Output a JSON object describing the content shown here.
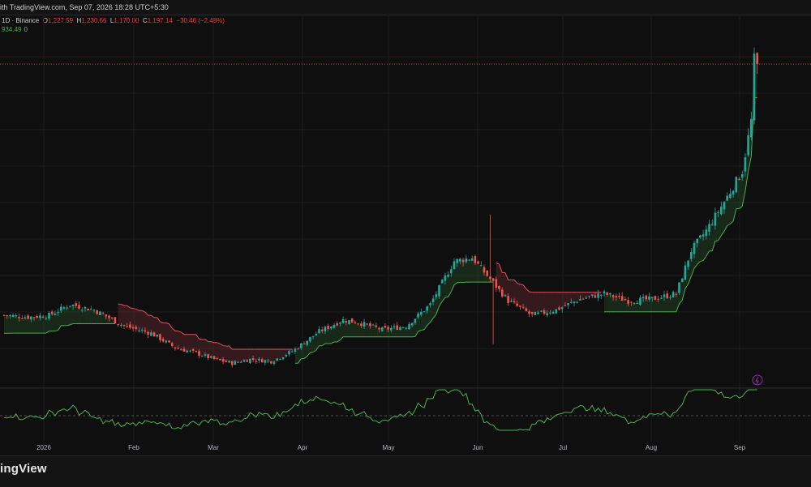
{
  "header": {
    "published_text": "ith TradingView.com, Sep 07, 2026 18:28 UTC+5:30"
  },
  "legend": {
    "interval_exchange": "1D · Binance",
    "o_label": "O",
    "open": "1,227.59",
    "h_label": "H",
    "high": "1,230.66",
    "l_label": "L",
    "low": "1,170.00",
    "c_label": "C",
    "close": "1,197.14",
    "change": "−30.46 (−2.48%)",
    "indicator_value": "934.49",
    "indicator_zero": "0"
  },
  "brand": {
    "text": "ingView"
  },
  "colors": {
    "background": "#0f0f0f",
    "up": "#26a69a",
    "down": "#ef5350",
    "trail_bear": "#e05060",
    "trail_bull": "#4caf50",
    "oscillator": "#4caf50",
    "accent_purple": "#9c27b0"
  },
  "chart_data": {
    "type": "candlestick",
    "xlabel": "",
    "ylabel": "",
    "x_ticks": [
      "2026",
      "Feb",
      "Mar",
      "Apr",
      "May",
      "Jun",
      "Jul",
      "Aug",
      "Sep"
    ],
    "last_close": 1197.14,
    "ylim": [
      300,
      1330
    ],
    "close_path": [
      [
        0,
        500
      ],
      [
        8,
        495
      ],
      [
        15,
        500
      ],
      [
        22,
        530
      ],
      [
        30,
        515
      ],
      [
        40,
        470
      ],
      [
        49,
        450
      ],
      [
        57,
        410
      ],
      [
        64,
        395
      ],
      [
        70,
        378
      ],
      [
        76,
        367
      ],
      [
        82,
        378
      ],
      [
        89,
        372
      ],
      [
        96,
        400
      ],
      [
        105,
        455
      ],
      [
        113,
        487
      ],
      [
        118,
        480
      ],
      [
        126,
        460
      ],
      [
        134,
        470
      ],
      [
        142,
        530
      ],
      [
        150,
        650
      ],
      [
        156,
        660
      ],
      [
        162,
        600
      ],
      [
        168,
        540
      ],
      [
        176,
        500
      ],
      [
        184,
        515
      ],
      [
        192,
        545
      ],
      [
        200,
        560
      ],
      [
        208,
        540
      ],
      [
        216,
        545
      ],
      [
        224,
        560
      ],
      [
        229,
        680
      ],
      [
        234,
        735
      ],
      [
        240,
        815
      ],
      [
        246,
        900
      ],
      [
        249,
        1040
      ],
      [
        250,
        1210
      ],
      [
        251,
        1197.14
      ]
    ]
  },
  "indicator": {
    "name": "oscillator",
    "baseline_dashed": true
  }
}
